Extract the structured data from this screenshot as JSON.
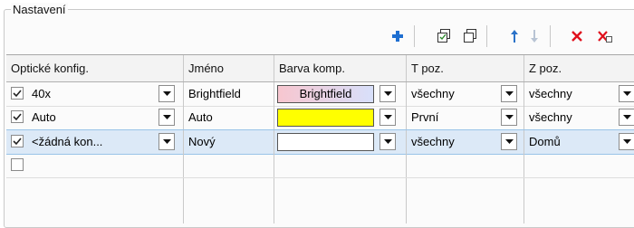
{
  "group": {
    "title": "Nastavení"
  },
  "toolbar": {
    "buttons": [
      {
        "name": "add-icon"
      },
      {
        "name": "copy-icon"
      },
      {
        "name": "paste-icon"
      },
      {
        "name": "move-up-icon"
      },
      {
        "name": "move-down-icon"
      },
      {
        "name": "delete-icon"
      },
      {
        "name": "delete-all-icon"
      }
    ]
  },
  "columns": [
    "Optické konfig.",
    "Jméno",
    "Barva komp.",
    "T poz.",
    "Z poz."
  ],
  "rows": [
    {
      "checked": true,
      "config": "40x",
      "name": "Brightfield",
      "color_label": "Brightfield",
      "color": "gradient-pink-blue",
      "t": "všechny",
      "z": "všechny"
    },
    {
      "checked": true,
      "config": "Auto",
      "name": "Auto",
      "color_label": "",
      "color": "#ffff00",
      "t": "První",
      "z": "všechny"
    },
    {
      "checked": true,
      "config": "<žádná kon...",
      "name": "Nový",
      "color_label": "",
      "color": "#ffffff",
      "t": "všechny",
      "z": "Domů"
    }
  ],
  "empty_row": {
    "checked": false
  },
  "colors": {
    "add": "#1e6fd1",
    "delete": "#e0101c",
    "arrow_active": "#2a72c8",
    "arrow_disabled": "#b8c4d4",
    "selection": "#dce9f7"
  }
}
